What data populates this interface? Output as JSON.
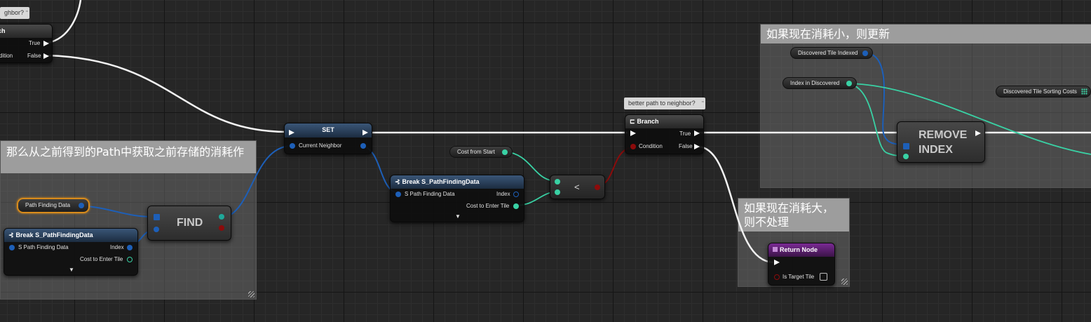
{
  "comments": {
    "update_if_smaller": "如果现在消耗小，则更新",
    "skip_if_larger": "如果现在消耗大，\n则不处理",
    "get_previous_cost": "那么从之前得到的Path中获取之前存储的消耗作"
  },
  "bubbles": {
    "top_left": "ghbor?",
    "branch_main": "better path to neighbor?",
    "pin_mark": "≈"
  },
  "nodes": {
    "branch_top": {
      "title": "ch",
      "true_label": "True",
      "condition_label": "dition",
      "false_label": "False"
    },
    "set": {
      "title": "SET",
      "pin_label": "Current Neighbor"
    },
    "break_mid": {
      "title": "Break S_PathFindingData",
      "input_label": "S Path Finding Data",
      "index_label": "Index",
      "cost_label": "Cost to Enter Tile",
      "expand_glyph": "▼"
    },
    "break_left": {
      "title": "Break S_PathFindingData",
      "input_label": "S Path Finding Data",
      "index_label": "Index",
      "cost_label": "Cost to Enter Tile",
      "expand_glyph": "▼"
    },
    "find": {
      "title": "FIND"
    },
    "less": {
      "symbol": "<"
    },
    "branch_main": {
      "title": "Branch",
      "true_label": "True",
      "condition_label": "Condition",
      "false_label": "False"
    },
    "remove_index": {
      "title_line1": "REMOVE",
      "title_line2": "INDEX"
    },
    "return_node": {
      "title": "Return Node",
      "pin_label": "Is Target Tile"
    }
  },
  "variables": {
    "cost_from_start": "Cost from Start",
    "path_finding_data": "Path Finding Data",
    "discovered_tile_indexed": "Discovered Tile Indexed",
    "index_in_discovered": "Index in Discovered",
    "discovered_tile_sorting_costs": "Discovered Tile Sorting Costs"
  },
  "colors": {
    "exec": "#ffffff",
    "struct": "#1d5fb8",
    "float": "#39d1a4",
    "bool": "#8c0b0b",
    "int": "#1fa89a",
    "array_highlight": "#d88b1b"
  }
}
